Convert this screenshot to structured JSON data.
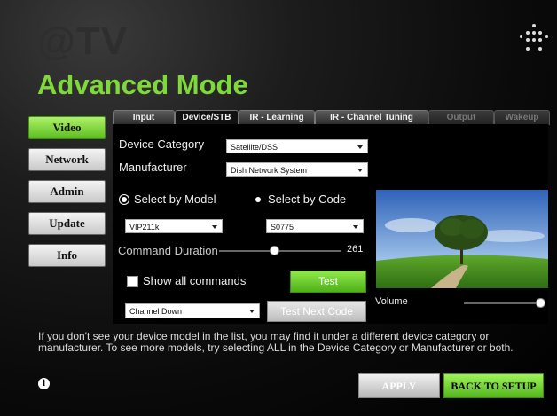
{
  "header": {
    "logo": "@TV",
    "title": "Advanced Mode"
  },
  "sidebar": {
    "items": [
      {
        "label": "Video",
        "active": true
      },
      {
        "label": "Network",
        "active": false
      },
      {
        "label": "Admin",
        "active": false
      },
      {
        "label": "Update",
        "active": false
      },
      {
        "label": "Info",
        "active": false
      }
    ]
  },
  "tabs": [
    {
      "label": "Input",
      "state": "normal"
    },
    {
      "label": "Device/STB",
      "state": "active"
    },
    {
      "label": "IR - Learning",
      "state": "normal"
    },
    {
      "label": "IR - Channel Tuning",
      "state": "normal"
    },
    {
      "label": "Output",
      "state": "disabled"
    },
    {
      "label": "Wakeup",
      "state": "disabled"
    }
  ],
  "form": {
    "device_category_label": "Device Category",
    "device_category_value": "Satellite/DSS",
    "manufacturer_label": "Manufacturer",
    "manufacturer_value": "Dish Network System",
    "select_by_model_label": "Select by Model",
    "select_by_code_label": "Select by Code",
    "model_value": "VIP211k",
    "code_value": "S0775",
    "command_duration_label": "Command Duration",
    "command_duration_value": "261",
    "command_duration_fraction": 0.45,
    "show_all_label": "Show all commands",
    "show_all_checked": false,
    "test_label": "Test",
    "command_value": "Channel Down",
    "test_next_label": "Test Next Code",
    "volume_label": "Volume",
    "volume_fraction": 1.0
  },
  "help_text": "If you don't see your device model in the list, you may find it under a different device category or manufacturer. To see more models, try selecting ALL in the Device Category or Manufacturer or both.",
  "footer": {
    "apply_label": "APPLY",
    "back_label": "BACK TO SETUP"
  },
  "colors": {
    "accent_green": "#7fd93a",
    "button_green": "#5cbf1e"
  }
}
